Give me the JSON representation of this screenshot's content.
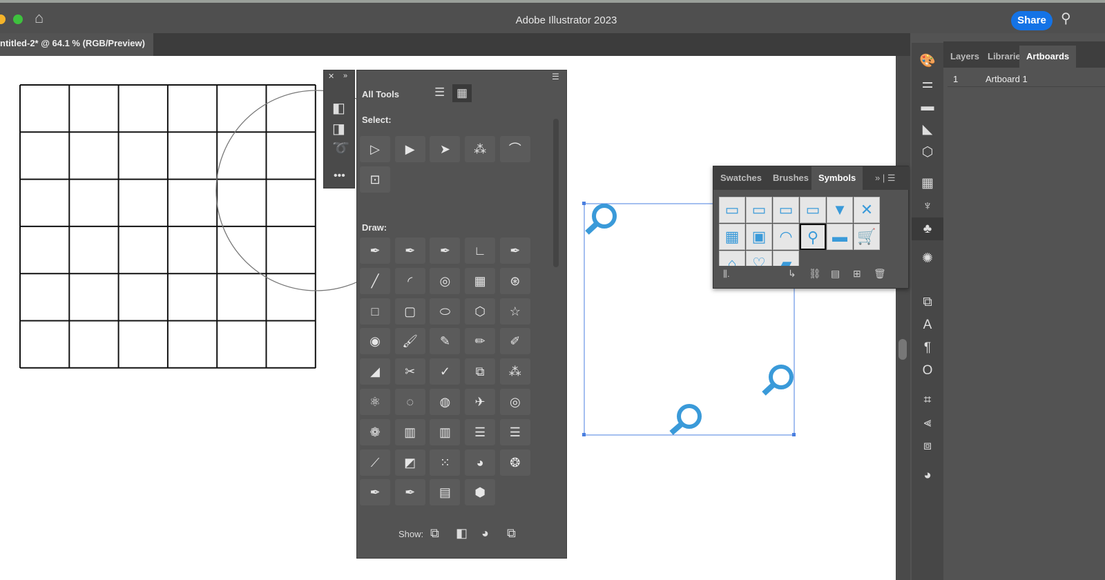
{
  "app": {
    "title": "Adobe Illustrator 2023",
    "share_label": "Share",
    "doc_tab": "ntitled-2* @ 64.1 % (RGB/Preview)"
  },
  "colors": {
    "accent": "#1473e6",
    "symbol_blue": "#3a9ad9",
    "selection": "#4a7fe0"
  },
  "right_panel": {
    "tabs": [
      "Layers",
      "Librarie",
      "Artboards"
    ],
    "active_tab": "Artboards",
    "rows": [
      {
        "num": "1",
        "name": "Artboard 1"
      }
    ]
  },
  "tools_panel": {
    "title": "All Tools",
    "select_label": "Select:",
    "draw_label": "Draw:",
    "show_label": "Show:",
    "select_tools": [
      "▷",
      "▶",
      "➤",
      "⁂",
      "⌒",
      "⊡"
    ],
    "draw_tools": [
      "✒",
      "✒",
      "✒",
      "∟",
      "✒",
      "╱",
      "◜",
      "◎",
      "▦",
      "⊛",
      "□",
      "▢",
      "⬭",
      "⬡",
      "☆",
      "◉",
      "🖌",
      "✎",
      "✏",
      "✐",
      "◢",
      "✂",
      "✓",
      "⧉",
      "⁂",
      "⚛",
      "◌",
      "◍",
      "✈",
      "◎",
      "❁",
      "▥",
      "▥",
      "☰",
      "☰",
      "⟋",
      "◩",
      "⁙",
      "◕",
      "❂",
      "✒",
      "✒",
      "▤",
      "⬢"
    ]
  },
  "symbols_panel": {
    "tabs": [
      "Swatches",
      "Brushes",
      "Symbols"
    ],
    "active_tab": "Symbols",
    "symbols": [
      "▭",
      "▭",
      "▭",
      "▭",
      "▼",
      "✕",
      "▦",
      "▣",
      "◠",
      "⚲",
      "▬",
      "🛒",
      "⌂",
      "♡",
      "▰"
    ]
  }
}
